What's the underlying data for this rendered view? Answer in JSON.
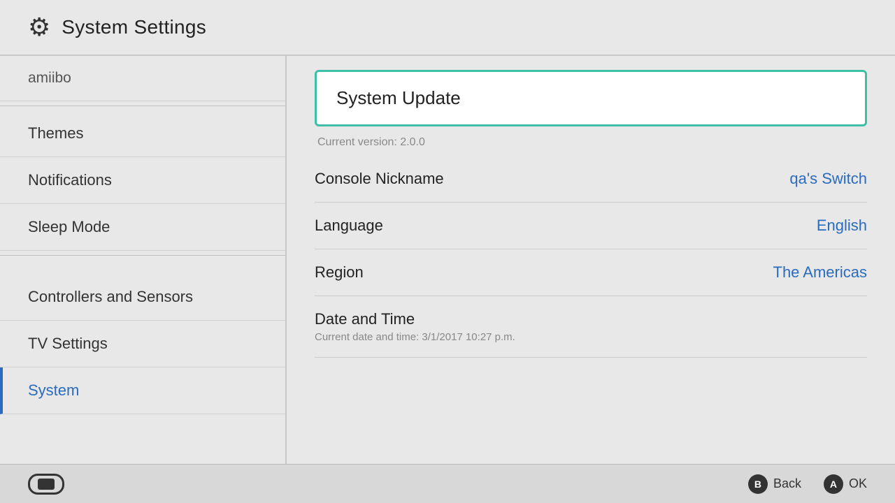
{
  "header": {
    "icon": "⚙",
    "title": "System Settings"
  },
  "sidebar": {
    "items": [
      {
        "id": "amiibo",
        "label": "amiibo",
        "active": false,
        "dividerAfter": true
      },
      {
        "id": "themes",
        "label": "Themes",
        "active": false,
        "dividerAfter": false
      },
      {
        "id": "notifications",
        "label": "Notifications",
        "active": false,
        "dividerAfter": false
      },
      {
        "id": "sleep-mode",
        "label": "Sleep Mode",
        "active": false,
        "dividerAfter": true
      },
      {
        "id": "controllers-and-sensors",
        "label": "Controllers and Sensors",
        "active": false,
        "dividerAfter": false
      },
      {
        "id": "tv-settings",
        "label": "TV Settings",
        "active": false,
        "dividerAfter": false
      },
      {
        "id": "system",
        "label": "System",
        "active": true,
        "dividerAfter": false
      }
    ]
  },
  "content": {
    "system_update": {
      "title": "System Update",
      "subtitle": "Current version: 2.0.0"
    },
    "rows": [
      {
        "id": "console-nickname",
        "label": "Console Nickname",
        "value": "qa's Switch"
      },
      {
        "id": "language",
        "label": "Language",
        "value": "English"
      },
      {
        "id": "region",
        "label": "Region",
        "value": "The Americas"
      },
      {
        "id": "date-and-time",
        "label": "Date and Time",
        "value": "",
        "subtitle": "Current date and time: 3/1/2017 10:27 p.m."
      }
    ]
  },
  "bottom_bar": {
    "back_label": "Back",
    "ok_label": "OK",
    "b_button": "B",
    "a_button": "A"
  }
}
